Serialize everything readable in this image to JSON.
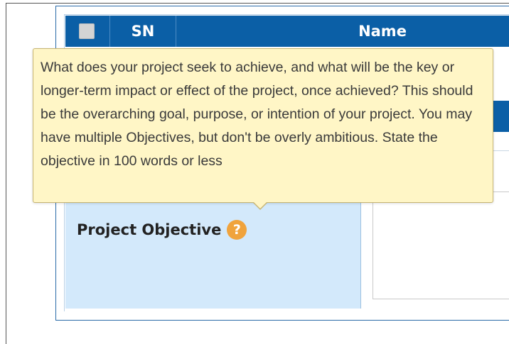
{
  "table": {
    "headers": {
      "sn": "SN",
      "name": "Name"
    }
  },
  "field": {
    "label": "Project Objective",
    "help_icon": "question-mark-icon",
    "help_glyph": "?"
  },
  "tooltip": {
    "text": "What does your project seek to achieve, and what will be the key or longer-term impact or effect of the project, once achieved? This should be the overarching goal, purpose, or intention of your project. You may have multiple Objectives, but don't be overly ambitious. State the objective in 100 words or less"
  },
  "colors": {
    "header_bg": "#0b5fa6",
    "label_bg": "#d3e9fb",
    "tooltip_bg": "#fff6c6",
    "help_icon": "#f0a33c"
  }
}
